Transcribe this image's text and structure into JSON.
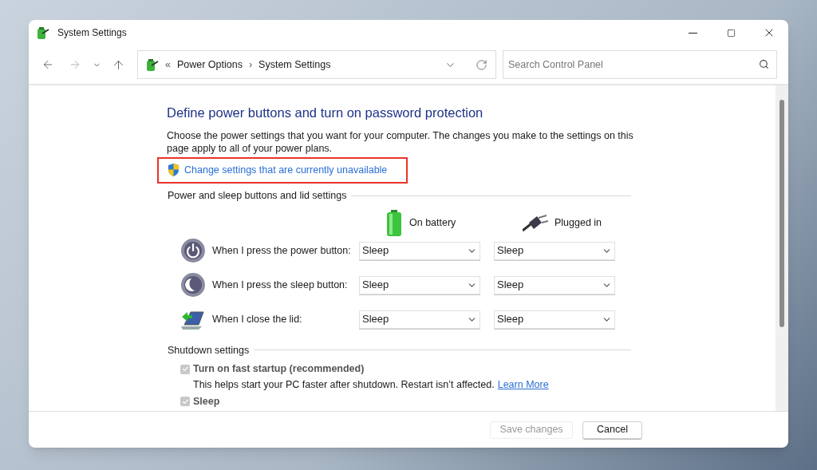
{
  "window": {
    "title": "System Settings"
  },
  "address_bar": {
    "prefix": "«",
    "separator": "›",
    "crumbs": [
      "Power Options",
      "System Settings"
    ]
  },
  "search": {
    "placeholder": "Search Control Panel"
  },
  "heading": "Define power buttons and turn on password protection",
  "description": "Choose the power settings that you want for your computer. The changes you make to the settings on this page apply to all of your power plans.",
  "admin_link": {
    "label": "Change settings that are currently unavailable",
    "highlighted": true
  },
  "buttons_section": {
    "title": "Power and sleep buttons and lid settings",
    "columns": [
      {
        "kind": "battery",
        "label": "On battery"
      },
      {
        "kind": "plug",
        "label": "Plugged in"
      }
    ],
    "rows": [
      {
        "kind": "power",
        "label": "When I press the power button:",
        "values": [
          "Sleep",
          "Sleep"
        ]
      },
      {
        "kind": "sleep",
        "label": "When I press the sleep button:",
        "values": [
          "Sleep",
          "Sleep"
        ]
      },
      {
        "kind": "lid",
        "label": "When I close the lid:",
        "values": [
          "Sleep",
          "Sleep"
        ]
      }
    ]
  },
  "shutdown_section": {
    "title": "Shutdown settings",
    "items": [
      {
        "label": "Turn on fast startup (recommended)",
        "checked": true,
        "disabled": true,
        "note": "This helps start your PC faster after shutdown. Restart isn’t affected.",
        "link": "Learn More"
      },
      {
        "label": "Sleep",
        "checked": true,
        "disabled": true
      }
    ]
  },
  "footer_buttons": [
    {
      "label": "Save changes",
      "disabled": true
    },
    {
      "label": "Cancel",
      "disabled": false
    }
  ]
}
